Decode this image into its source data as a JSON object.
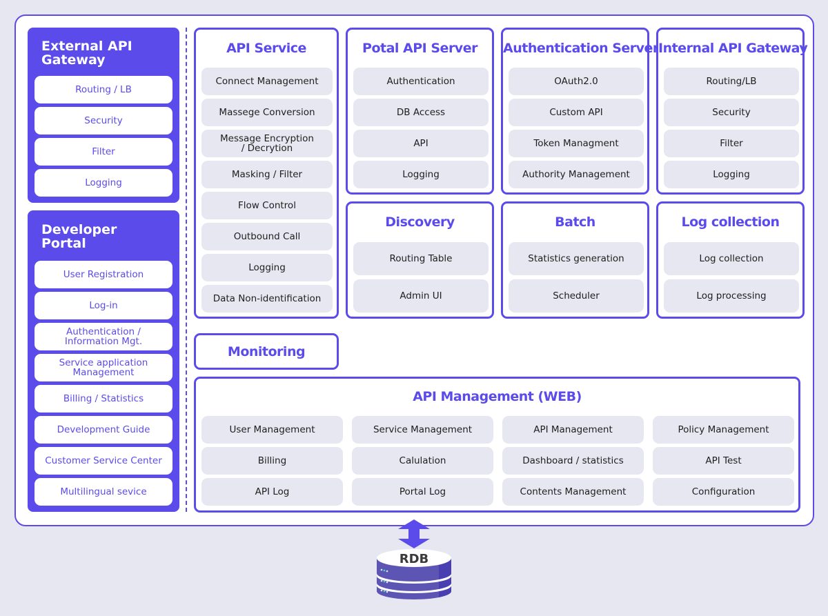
{
  "colors": {
    "accent": "#5b4bea",
    "background": "#e7e7f1",
    "item_bg": "#e7e7f1",
    "panel_text": "#ffffff",
    "item_text": "#1e1e1e"
  },
  "external_gateway": {
    "title": "External API\nGateway",
    "items": [
      "Routing / LB",
      "Security",
      "Filter",
      "Logging"
    ]
  },
  "developer_portal": {
    "title": "Developer\nPortal",
    "items": [
      "User Registration",
      "Log-in",
      "Authentication /\nInformation Mgt.",
      "Service application\nManagement",
      "Billing / Statistics",
      "Development Guide",
      "Customer Service Center",
      "Multilingual sevice"
    ]
  },
  "api_service": {
    "title": "API Service",
    "items": [
      "Connect Management",
      "Massege Conversion",
      "Message Encryption\n/ Decrytion",
      "Masking / Filter",
      "Flow Control",
      "Outbound Call",
      "Logging",
      "Data Non-identification"
    ]
  },
  "portal_api_server": {
    "title": "Potal API Server",
    "items": [
      "Authentication",
      "DB Access",
      "API",
      "Logging"
    ]
  },
  "authentication_server": {
    "title": "Authentication Server",
    "items": [
      "OAuth2.0",
      "Custom API",
      "Token Managment",
      "Authority Management"
    ]
  },
  "internal_gateway": {
    "title": "Internal API Gateway",
    "items": [
      "Routing/LB",
      "Security",
      "Filter",
      "Logging"
    ]
  },
  "discovery": {
    "title": "Discovery",
    "items": [
      "Routing Table",
      "Admin UI"
    ]
  },
  "batch": {
    "title": "Batch",
    "items": [
      "Statistics generation",
      "Scheduler"
    ]
  },
  "log_collection": {
    "title": "Log collection",
    "items": [
      "Log collection",
      "Log processing"
    ]
  },
  "monitoring": {
    "title": "Monitoring"
  },
  "api_management": {
    "title": "API Management (WEB)",
    "items": [
      "User Management",
      "Service Management",
      "API Management",
      "Policy Management",
      "Billing",
      "Calulation",
      "Dashboard / statistics",
      "API Test",
      "API Log",
      "Portal Log",
      "Contents Management",
      "Configuration"
    ]
  },
  "database": {
    "label": "RDB",
    "icon": "database-icon",
    "connector_icon": "double-arrow-vertical-icon"
  }
}
